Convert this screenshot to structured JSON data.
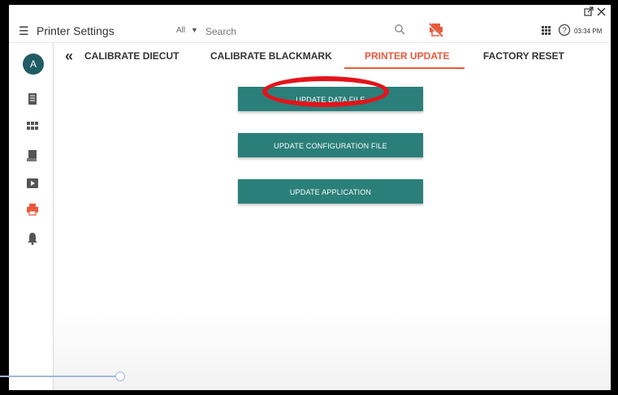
{
  "header": {
    "title": "Printer Settings",
    "filter_value": "All",
    "search_placeholder": "Search",
    "time": "03:34 PM"
  },
  "sidebar": {
    "avatar_letter": "A",
    "items": [
      {
        "icon": "document-icon"
      },
      {
        "icon": "grid-icon"
      },
      {
        "icon": "receipt-icon"
      },
      {
        "icon": "video-icon"
      },
      {
        "icon": "printer-icon",
        "active": true
      },
      {
        "icon": "bell-icon"
      }
    ]
  },
  "tabs": [
    {
      "label": "CALIBRATE DIECUT"
    },
    {
      "label": "CALIBRATE BLACKMARK"
    },
    {
      "label": "PRINTER UPDATE",
      "active": true
    },
    {
      "label": "FACTORY RESET"
    }
  ],
  "actions": {
    "update_data_file": "UPDATE DATA FILE",
    "update_configuration_file": "UPDATE CONFIGURATION FILE",
    "update_application": "UPDATE APPLICATION"
  },
  "colors": {
    "accent": "#e8593c",
    "button": "#2b7f7a",
    "avatar": "#1f5c63",
    "annotation": "#e3141b"
  }
}
